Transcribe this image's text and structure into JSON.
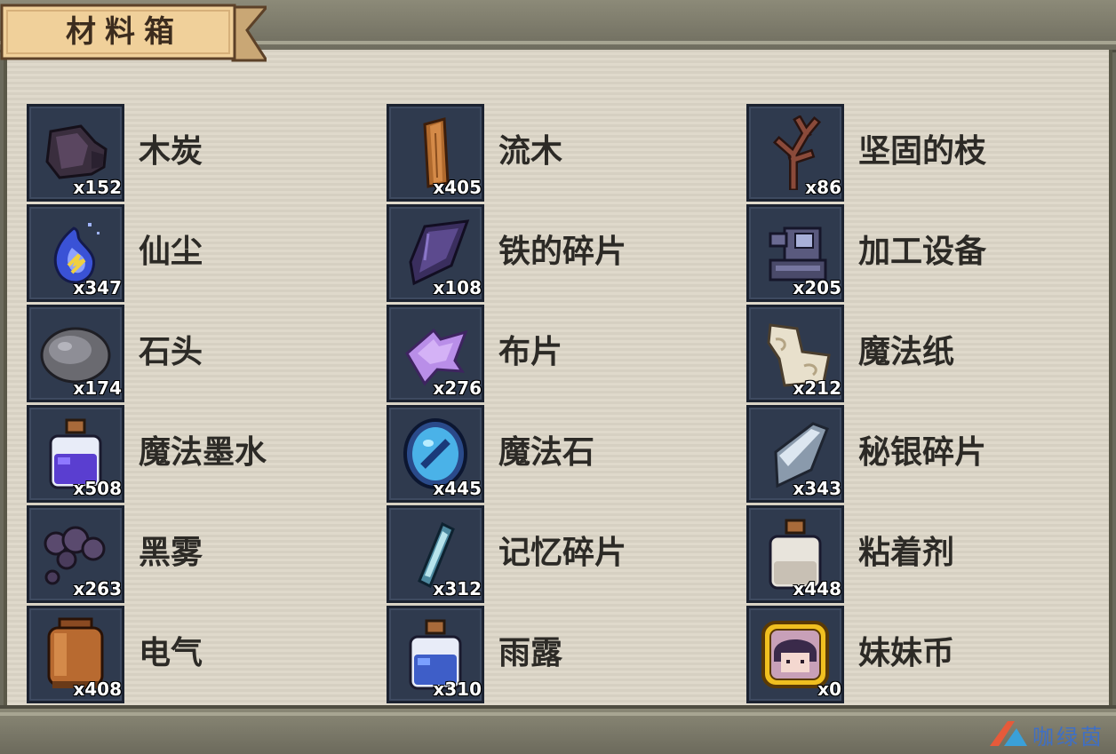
{
  "header": {
    "title": "材料箱"
  },
  "watermark": {
    "text": "咖绿茵"
  },
  "items": [
    {
      "name": "木炭",
      "count": "x152",
      "icon": "charcoal-icon"
    },
    {
      "name": "流木",
      "count": "x405",
      "icon": "driftwood-icon"
    },
    {
      "name": "坚固的枝",
      "count": "x86",
      "icon": "sturdy-branch-icon"
    },
    {
      "name": "仙尘",
      "count": "x347",
      "icon": "fairy-dust-icon"
    },
    {
      "name": "铁的碎片",
      "count": "x108",
      "icon": "iron-fragment-icon"
    },
    {
      "name": "加工设备",
      "count": "x205",
      "icon": "processing-equipment-icon"
    },
    {
      "name": "石头",
      "count": "x174",
      "icon": "stone-icon"
    },
    {
      "name": "布片",
      "count": "x276",
      "icon": "cloth-piece-icon"
    },
    {
      "name": "魔法纸",
      "count": "x212",
      "icon": "magic-paper-icon"
    },
    {
      "name": "魔法墨水",
      "count": "x508",
      "icon": "magic-ink-icon"
    },
    {
      "name": "魔法石",
      "count": "x445",
      "icon": "magic-stone-icon"
    },
    {
      "name": "秘银碎片",
      "count": "x343",
      "icon": "mithril-fragment-icon"
    },
    {
      "name": "黑雾",
      "count": "x263",
      "icon": "black-fog-icon"
    },
    {
      "name": "记忆碎片",
      "count": "x312",
      "icon": "memory-fragment-icon"
    },
    {
      "name": "粘着剂",
      "count": "x448",
      "icon": "adhesive-icon"
    },
    {
      "name": "电气",
      "count": "x408",
      "icon": "electricity-icon"
    },
    {
      "name": "雨露",
      "count": "x310",
      "icon": "rain-dew-icon"
    },
    {
      "name": "妹妹币",
      "count": "x0",
      "icon": "sister-coin-icon"
    }
  ]
}
